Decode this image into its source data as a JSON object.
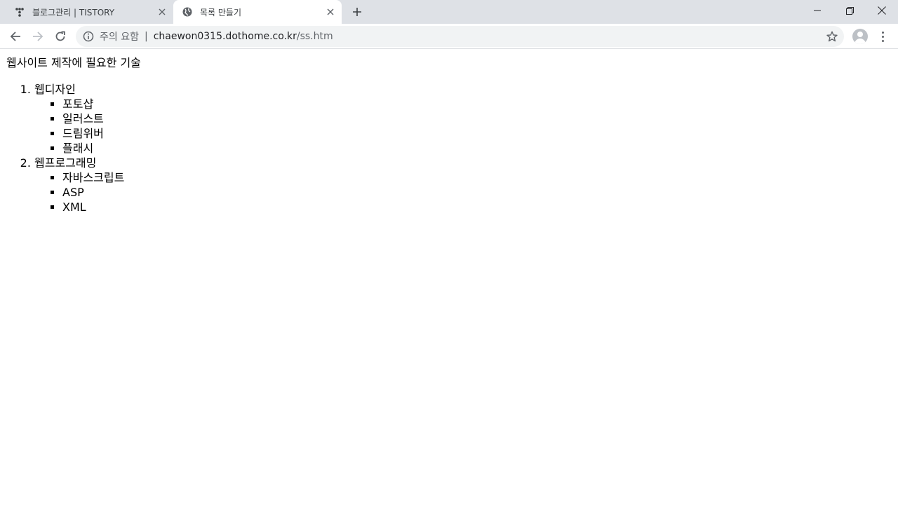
{
  "browser": {
    "tabs": [
      {
        "title": "블로그관리 | TISTORY",
        "icon": "tistory-icon",
        "active": false
      },
      {
        "title": "목록 만들기",
        "icon": "globe-icon",
        "active": true
      }
    ],
    "address": {
      "warning": "주의 요함",
      "separator": "|",
      "host": "chaewon0315.dothome.co.kr",
      "path": "/ss.htm"
    }
  },
  "page": {
    "heading": "웹사이트 제작에 필요한 기술",
    "list": [
      {
        "label": "웹디자인",
        "items": [
          "포토샵",
          "일러스트",
          "드림위버",
          "플래시"
        ]
      },
      {
        "label": "웹프로그래밍",
        "items": [
          "자바스크립트",
          "ASP",
          "XML"
        ]
      }
    ]
  },
  "colors": {
    "tabstrip": "#dee1e6",
    "omnibox": "#f1f3f4",
    "icon": "#5f6368"
  }
}
